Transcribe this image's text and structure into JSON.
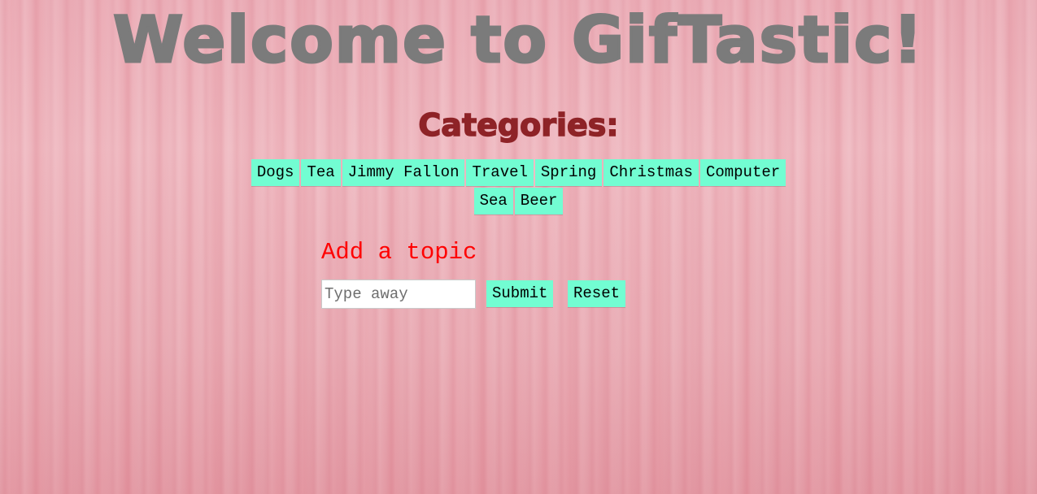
{
  "header": {
    "title": "Welcome to GifTastic!"
  },
  "categories": {
    "heading": "Categories:",
    "row1": [
      "Dogs",
      "Tea",
      "Jimmy Fallon",
      "Travel",
      "Spring",
      "Christmas",
      "Computer"
    ],
    "row2": [
      "Sea",
      "Beer"
    ]
  },
  "form": {
    "heading": "Add a topic",
    "input_placeholder": "Type away",
    "input_value": "",
    "submit_label": "Submit",
    "reset_label": "Reset"
  },
  "colors": {
    "title": "#7b7b7b",
    "categories_heading": "#8e2327",
    "button_bg": "#72fdd2",
    "add_topic": "#ff0000",
    "background": "#f0bfc6"
  }
}
